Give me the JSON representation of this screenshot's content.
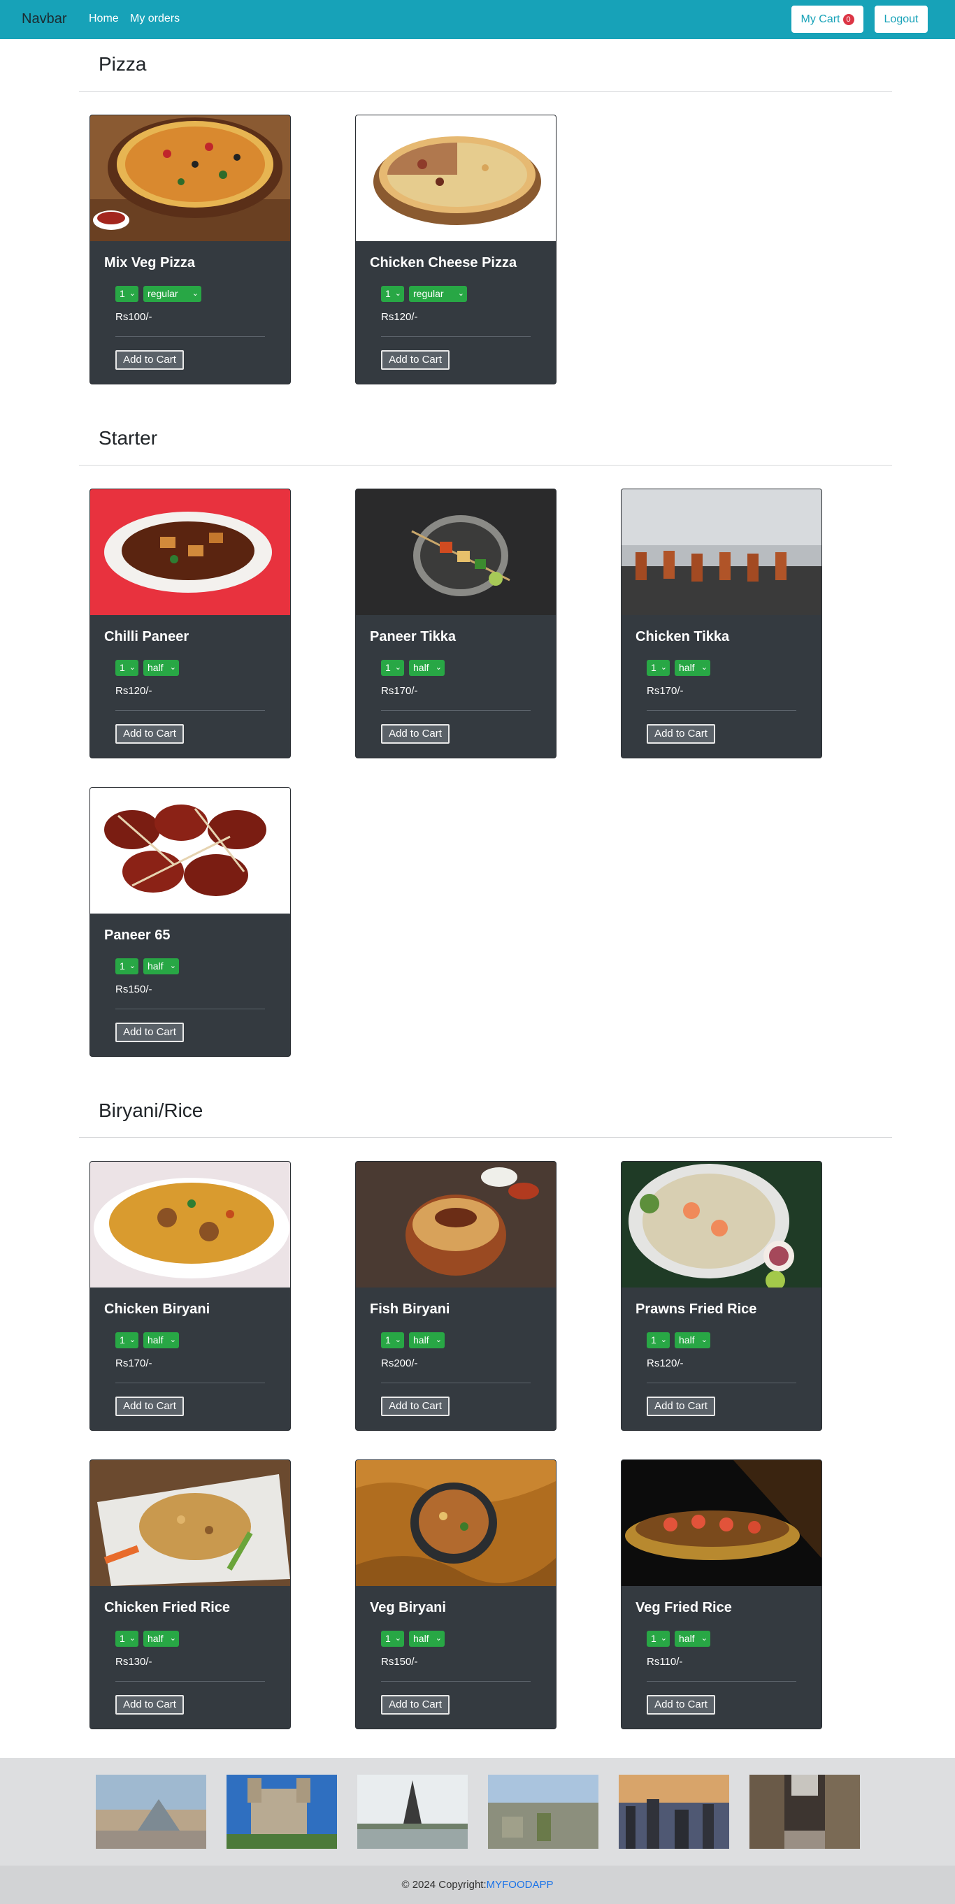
{
  "navbar": {
    "brand": "Navbar",
    "links": [
      "Home",
      "My orders"
    ],
    "cart_label": "My Cart",
    "cart_count": "0",
    "logout_label": "Logout"
  },
  "sections": [
    {
      "title": "Pizza",
      "items": [
        {
          "name": "Mix Veg Pizza",
          "qty": "1",
          "size": "regular",
          "price": "Rs100/-",
          "button": "Add to Cart"
        },
        {
          "name": "Chicken Cheese Pizza",
          "qty": "1",
          "size": "regular",
          "price": "Rs120/-",
          "button": "Add to Cart"
        }
      ]
    },
    {
      "title": "Starter",
      "items": [
        {
          "name": "Chilli Paneer",
          "qty": "1",
          "size": "half",
          "price": "Rs120/-",
          "button": "Add to Cart"
        },
        {
          "name": "Paneer Tikka",
          "qty": "1",
          "size": "half",
          "price": "Rs170/-",
          "button": "Add to Cart"
        },
        {
          "name": "Chicken Tikka",
          "qty": "1",
          "size": "half",
          "price": "Rs170/-",
          "button": "Add to Cart"
        },
        {
          "name": "Paneer 65",
          "qty": "1",
          "size": "half",
          "price": "Rs150/-",
          "button": "Add to Cart"
        }
      ]
    },
    {
      "title": "Biryani/Rice",
      "items": [
        {
          "name": "Chicken Biryani",
          "qty": "1",
          "size": "half",
          "price": "Rs170/-",
          "button": "Add to Cart"
        },
        {
          "name": "Fish Biryani",
          "qty": "1",
          "size": "half",
          "price": "Rs200/-",
          "button": "Add to Cart"
        },
        {
          "name": "Prawns Fried Rice",
          "qty": "1",
          "size": "half",
          "price": "Rs120/-",
          "button": "Add to Cart"
        },
        {
          "name": "Chicken Fried Rice",
          "qty": "1",
          "size": "half",
          "price": "Rs130/-",
          "button": "Add to Cart"
        },
        {
          "name": "Veg Biryani",
          "qty": "1",
          "size": "half",
          "price": "Rs150/-",
          "button": "Add to Cart"
        },
        {
          "name": "Veg Fried Rice",
          "qty": "1",
          "size": "half",
          "price": "Rs110/-",
          "button": "Add to Cart"
        }
      ]
    }
  ],
  "footer": {
    "copyright": "© 2024 Copyright:",
    "app_name": "MYFOODAPP"
  },
  "colors": {
    "navbar": "#17a2b8",
    "card": "#343a40",
    "select": "#28a745",
    "badge": "#dc3545",
    "link": "#1a73e8"
  }
}
